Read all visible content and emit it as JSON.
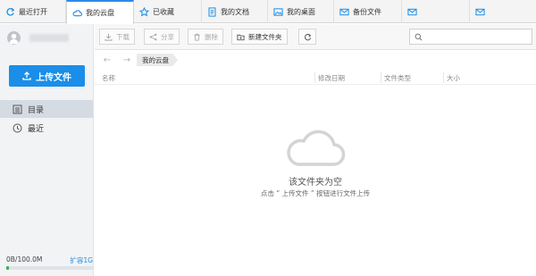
{
  "tabs": [
    {
      "label": "最近打开",
      "icon": "refresh-icon"
    },
    {
      "label": "我的云盘",
      "icon": "cloud-icon",
      "active": true
    },
    {
      "label": "已收藏",
      "icon": "star-icon"
    },
    {
      "label": "我的文档",
      "icon": "document-icon"
    },
    {
      "label": "我的桌面",
      "icon": "desktop-image-icon"
    },
    {
      "label": "备份文件",
      "icon": "mail-icon"
    },
    {
      "label": "",
      "icon": "mail-icon"
    },
    {
      "label": "",
      "icon": "mail-icon"
    }
  ],
  "sidebar": {
    "upload_label": "上传文件",
    "nav": [
      {
        "label": "目录",
        "icon": "list-icon",
        "active": true
      },
      {
        "label": "最近",
        "icon": "clock-icon"
      }
    ],
    "storage_text": "0B/100.0M",
    "storage_used_fraction": 0.01,
    "expand_label": "扩容1G"
  },
  "toolbar": {
    "download_label": "下载",
    "share_label": "分享",
    "delete_label": "删除",
    "new_folder_label": "新建文件夹",
    "search_placeholder": ""
  },
  "breadcrumb": {
    "current": "我的云盘"
  },
  "columns": {
    "name": "名称",
    "modified": "修改日期",
    "type": "文件类型",
    "size": "大小"
  },
  "empty_state": {
    "title": "该文件夹为空",
    "subtitle": "点击 “ 上传文件 ” 按钮进行文件上传"
  },
  "colors": {
    "accent": "#1a8ee8",
    "storage_fill": "#37b24d"
  }
}
